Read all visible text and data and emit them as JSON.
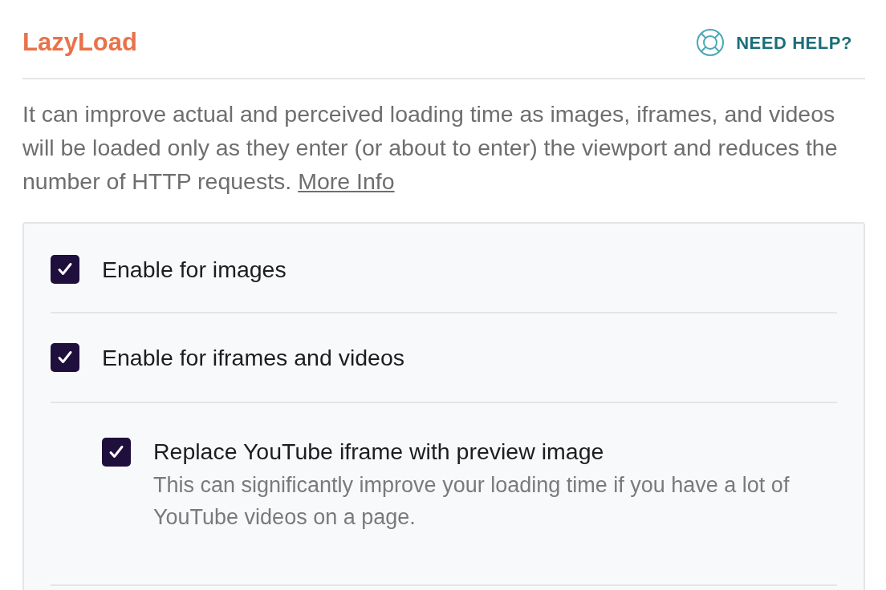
{
  "header": {
    "title": "LazyLoad",
    "help_link": "NEED HELP?"
  },
  "description": {
    "text": "It can improve actual and perceived loading time as images, iframes, and videos will be loaded only as they enter (or about to enter) the viewport and reduces the number of HTTP requests.",
    "link": "More Info"
  },
  "options": [
    {
      "label": "Enable for images",
      "checked": true
    },
    {
      "label": "Enable for iframes and videos",
      "checked": true,
      "children": [
        {
          "label": "Replace YouTube iframe with preview image",
          "checked": true,
          "description": "This can significantly improve your loading time if you have a lot of YouTube videos on a page."
        }
      ]
    }
  ]
}
